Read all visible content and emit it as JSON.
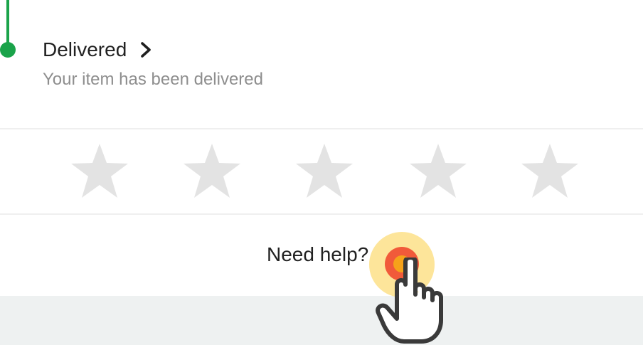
{
  "order_status": {
    "title": "Delivered",
    "subtitle": "Your item has been delivered",
    "accent_color": "#1aa34a",
    "chevron_icon": "chevron-right-icon"
  },
  "rating": {
    "max_stars": 5,
    "selected_stars": 0,
    "star_icon": "star-icon",
    "star_color": "#e3e3e3"
  },
  "help": {
    "label": "Need help?"
  },
  "tap_indicator": {
    "icon": "pointing-hand-icon"
  }
}
